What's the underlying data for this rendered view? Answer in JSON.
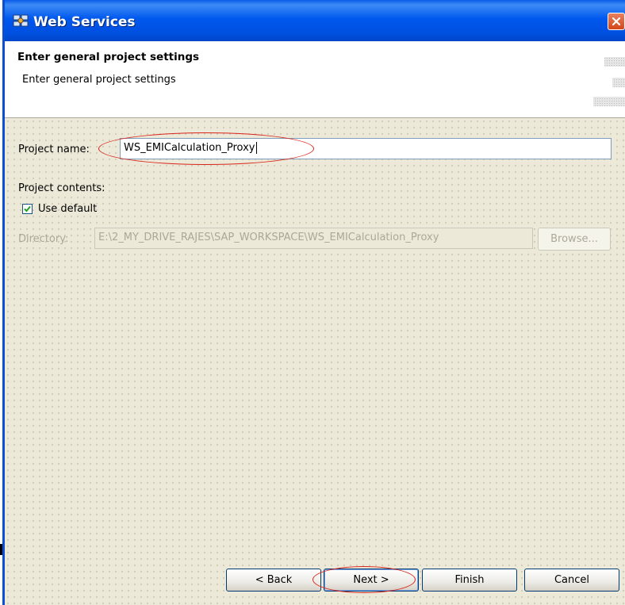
{
  "window": {
    "title": "Web Services",
    "icon": "web-services-icon",
    "close_icon": "close-icon"
  },
  "banner": {
    "title": "Enter general project settings",
    "description": "Enter general project settings"
  },
  "form": {
    "project_name_label": "Project name:",
    "project_name_value": "WS_EMICalculation_Proxy",
    "project_contents_label": "Project contents:",
    "use_default_label": "Use default",
    "use_default_checked": true,
    "directory_label": "Directory:",
    "directory_value": "E:\\2_MY_DRIVE_RAJES\\SAP_WORKSPACE\\WS_EMICalculation_Proxy",
    "browse_label": "Browse..."
  },
  "buttons": {
    "back": "< Back",
    "next": "Next >",
    "finish": "Finish",
    "cancel": "Cancel"
  },
  "colors": {
    "titlebar": "#0058EE",
    "annotation": "#D9261C",
    "dialog_bg": "#ECE9D8"
  }
}
